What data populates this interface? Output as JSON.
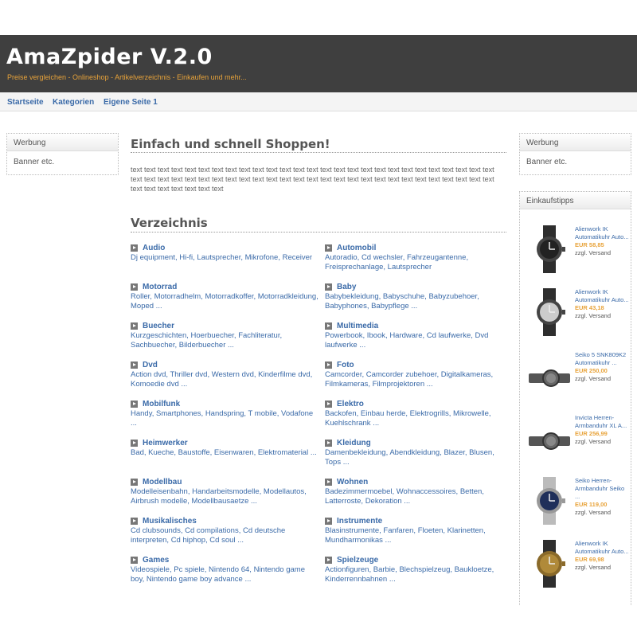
{
  "header": {
    "title": "AmaZpider V.2.0",
    "tagline": "Preise vergleichen - Onlineshop - Artikelverzeichnis - Einkaufen und mehr..."
  },
  "nav": [
    "Startseite",
    "Kategorien",
    "Eigene Seite 1"
  ],
  "left_box": {
    "title": "Werbung",
    "body": "Banner etc."
  },
  "right_box": {
    "title": "Werbung",
    "body": "Banner etc."
  },
  "main": {
    "heading": "Einfach und schnell Shoppen!",
    "intro": "text text text text text text text text text text text text text text text text text text text text text text text text text text text text text text text text text text text text text text text text text text text text text text text text text text text text text text text text text text text text text",
    "directory_heading": "Verzeichnis",
    "categories": [
      {
        "title": "Audio",
        "links": "Dj equipment, Hi-fi, Lautsprecher, Mikrofone, Receiver"
      },
      {
        "title": "Automobil",
        "links": "Autoradio, Cd wechsler, Fahrzeugantenne, Freisprechanlage, Lautsprecher"
      },
      {
        "title": "Motorrad",
        "links": "Roller, Motorradhelm, Motorradkoffer, Motorradkleidung, Moped ..."
      },
      {
        "title": "Baby",
        "links": "Babybekleidung, Babyschuhe, Babyzubehoer, Babyphones, Babypflege ..."
      },
      {
        "title": "Buecher",
        "links": "Kurzgeschichten, Hoerbuecher, Fachliteratur, Sachbuecher, Bilderbuecher ..."
      },
      {
        "title": "Multimedia",
        "links": "Powerbook, Ibook, Hardware, Cd laufwerke, Dvd laufwerke ..."
      },
      {
        "title": "Dvd",
        "links": "Action dvd, Thriller dvd, Western dvd, Kinderfilme dvd, Komoedie dvd ..."
      },
      {
        "title": "Foto",
        "links": "Camcorder, Camcorder zubehoer, Digitalkameras, Filmkameras, Filmprojektoren ..."
      },
      {
        "title": "Mobilfunk",
        "links": "Handy, Smartphones, Handspring, T mobile, Vodafone ..."
      },
      {
        "title": "Elektro",
        "links": "Backofen, Einbau herde, Elektrogrills, Mikrowelle, Kuehlschrank ..."
      },
      {
        "title": "Heimwerker",
        "links": "Bad, Kueche, Baustoffe, Eisenwaren, Elektromaterial ..."
      },
      {
        "title": "Kleidung",
        "links": "Damenbekleidung, Abendkleidung, Blazer, Blusen, Tops ..."
      },
      {
        "title": "Modellbau",
        "links": "Modelleisenbahn, Handarbeitsmodelle, Modellautos, Airbrush modelle, Modellbausaetze ..."
      },
      {
        "title": "Wohnen",
        "links": "Badezimmermoebel, Wohnaccessoires, Betten, Latterroste, Dekoration ..."
      },
      {
        "title": "Musikalisches",
        "links": "Cd clubsounds, Cd compilations, Cd deutsche interpreten, Cd hiphop, Cd soul ..."
      },
      {
        "title": "Instrumente",
        "links": "Blasinstrumente, Fanfaren, Floeten, Klarinetten, Mundharmonikas ..."
      },
      {
        "title": "Games",
        "links": "Videospiele, Pc spiele, Nintendo 64, Nintendo game boy, Nintendo game boy advance ..."
      },
      {
        "title": "Spielzeuge",
        "links": "Actionfiguren, Barbie, Blechspielzeug, Baukloetze, Kinderrennbahnen ..."
      }
    ]
  },
  "tips": {
    "title": "Einkaufstipps",
    "items": [
      {
        "name": "Alienwork IK Automatikuhr Auto...",
        "price": "EUR 58,85",
        "shipping": "zzgl. Versand"
      },
      {
        "name": "Alienwork IK Automatikuhr Auto...",
        "price": "EUR 43,18",
        "shipping": "zzgl. Versand"
      },
      {
        "name": "Seiko 5 SNK809K2 Automatikuhr ...",
        "price": "EUR 250,00",
        "shipping": "zzgl. Versand"
      },
      {
        "name": "Invicta Herren-Armbanduhr XL A...",
        "price": "EUR 256,99",
        "shipping": "zzgl. Versand"
      },
      {
        "name": "Seiko Herren-Armbanduhr Seiko ...",
        "price": "EUR 119,00",
        "shipping": "zzgl. Versand"
      },
      {
        "name": "Alienwork IK Automatikuhr Auto...",
        "price": "EUR 69,98",
        "shipping": "zzgl. Versand"
      }
    ]
  }
}
